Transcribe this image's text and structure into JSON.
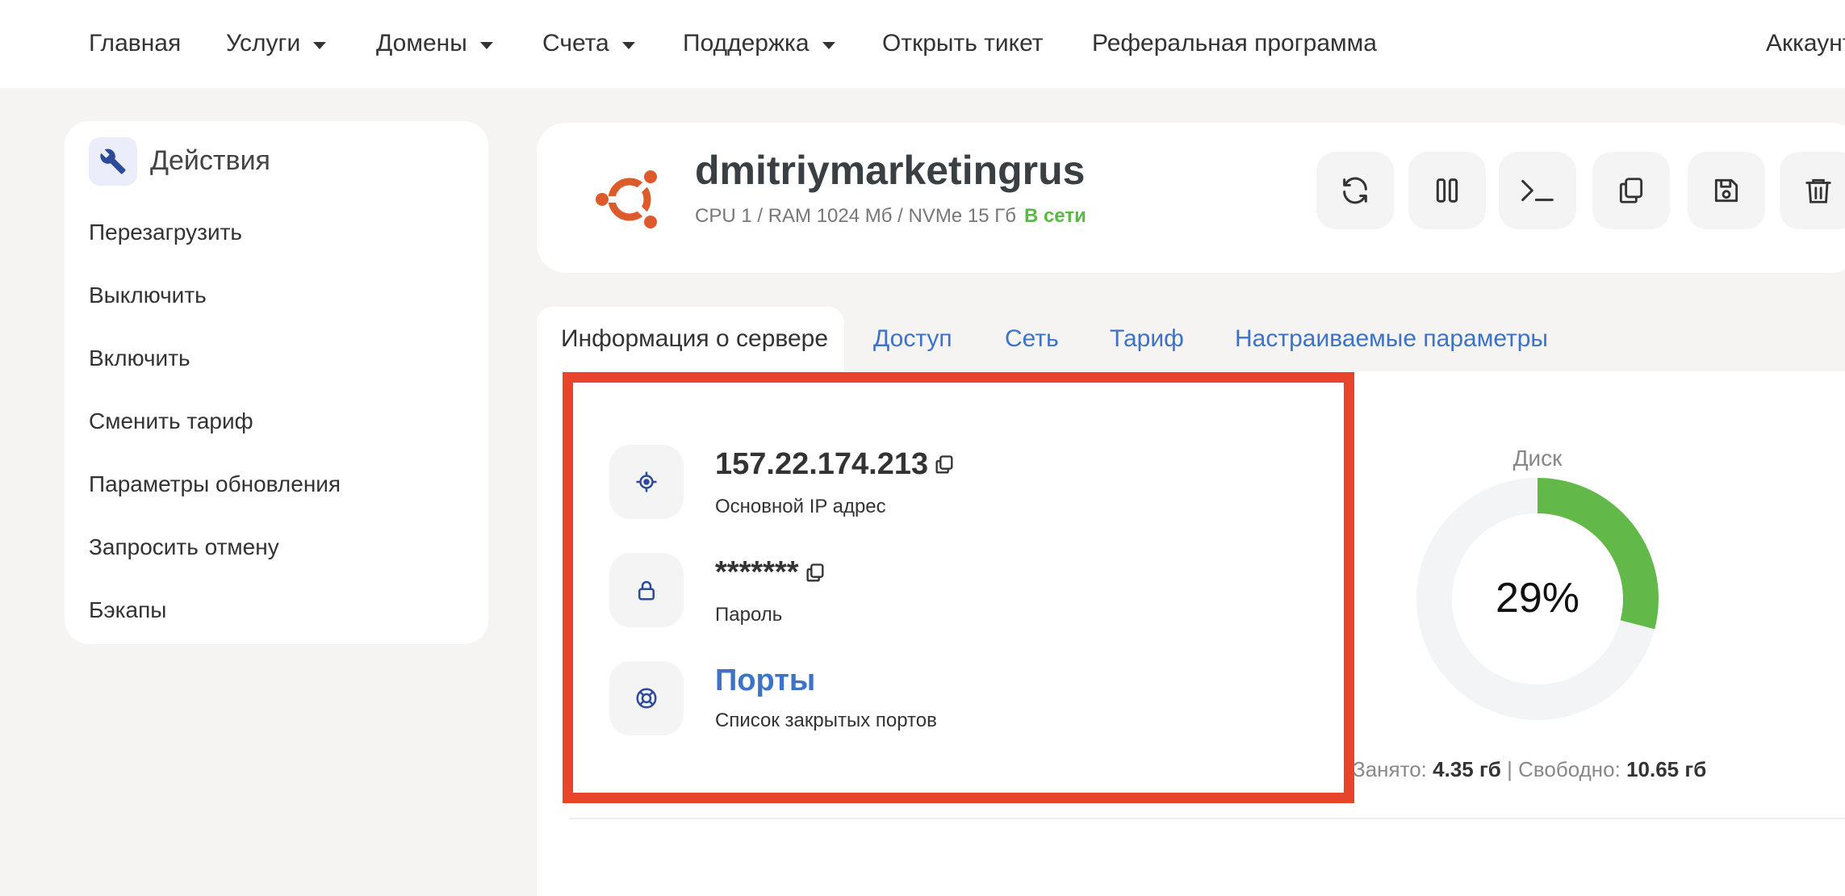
{
  "nav": {
    "items": [
      {
        "label": "Главная",
        "dropdown": false
      },
      {
        "label": "Услуги",
        "dropdown": true
      },
      {
        "label": "Домены",
        "dropdown": true
      },
      {
        "label": "Счета",
        "dropdown": true
      },
      {
        "label": "Поддержка",
        "dropdown": true
      },
      {
        "label": "Открыть тикет",
        "dropdown": false
      },
      {
        "label": "Реферальная программа",
        "dropdown": false
      }
    ],
    "account_label": "Аккаунт"
  },
  "sidebar": {
    "title": "Действия",
    "items": [
      {
        "label": "Перезагрузить"
      },
      {
        "label": "Выключить"
      },
      {
        "label": "Включить"
      },
      {
        "label": "Сменить тариф"
      },
      {
        "label": "Параметры обновления"
      },
      {
        "label": "Запросить отмену"
      },
      {
        "label": "Бэкапы"
      }
    ]
  },
  "server": {
    "name": "dmitriymarketingrus",
    "specs": "CPU 1 / RAM 1024 Мб / NVMe 15 Гб",
    "status": "В сети",
    "status_color": "#5ab847",
    "os_logo_color": "#dd5a2b",
    "actions": [
      {
        "icon": "refresh-icon"
      },
      {
        "icon": "pause-icon"
      },
      {
        "icon": "terminal-icon"
      },
      {
        "icon": "copy-icon"
      },
      {
        "icon": "save-icon"
      },
      {
        "icon": "trash-icon"
      }
    ]
  },
  "tabs": [
    {
      "label": "Информация о сервере",
      "active": true
    },
    {
      "label": "Доступ",
      "active": false
    },
    {
      "label": "Сеть",
      "active": false
    },
    {
      "label": "Тариф",
      "active": false
    },
    {
      "label": "Настраиваемые параметры",
      "active": false
    }
  ],
  "info": {
    "ip": {
      "value": "157.22.174.213",
      "label": "Основной IP адрес"
    },
    "password": {
      "value": "*******",
      "label": "Пароль"
    },
    "ports": {
      "value": "Порты",
      "label": "Список закрытых портов"
    }
  },
  "disk": {
    "title": "Диск",
    "percent_text": "29%",
    "used_fraction": 0.29,
    "used_label": "Занято:",
    "used_value": "4.35 гб",
    "separator": "|",
    "free_label": "Свободно:",
    "free_value": "10.65 гб",
    "used_color": "#62b849",
    "track_color": "#f3f4f6"
  },
  "colors": {
    "accent": "#3b73c9",
    "highlight": "#e8432b",
    "icon_blue": "#2c4a9a"
  }
}
